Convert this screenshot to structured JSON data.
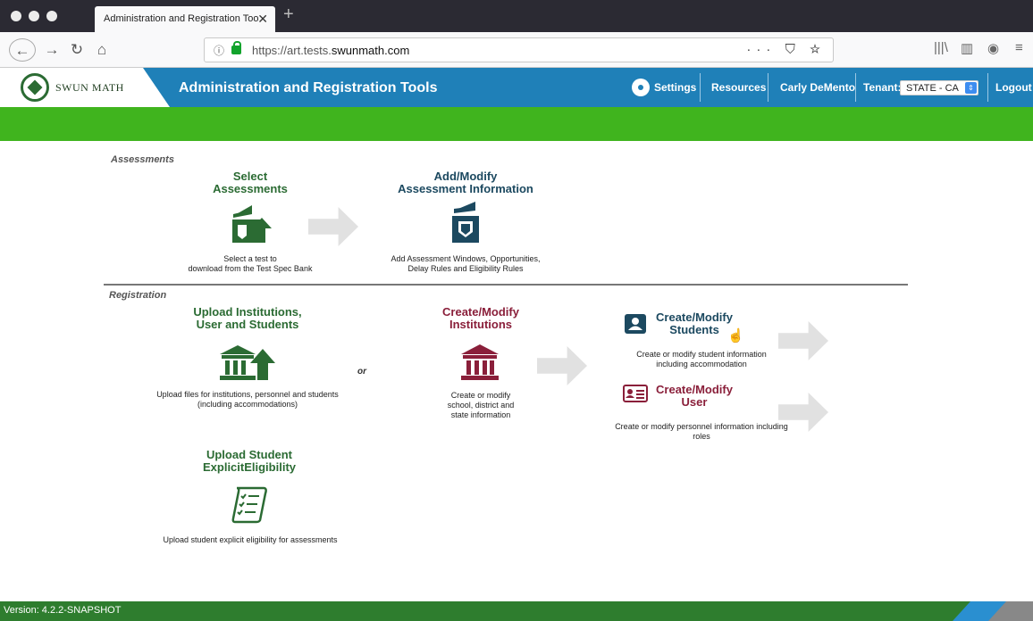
{
  "browser": {
    "tab_title": "Administration and Registration Too",
    "tab_close": "✕",
    "new_tab": "+",
    "url_prefix": "https://art.tests.",
    "url_domain": "swunmath.com",
    "url_actions": "··· ⛉ ☆",
    "back": "←",
    "forward": "→",
    "reload": "↻",
    "home": "⌂",
    "library": "|||\\",
    "sidebar": "▥",
    "extension": "◉",
    "menu": "≡"
  },
  "header": {
    "logo_text": "SWUN MATH",
    "app_title": "Administration and Registration Tools",
    "settings": "Settings",
    "resources": "Resources",
    "user": "Carly DeMento",
    "tenant_label": "Tenant:",
    "tenant_value": "STATE - CA",
    "logout": "Logout"
  },
  "assessments": {
    "section_label": "Assessments",
    "select": {
      "title_line1": "Select",
      "title_line2": "Assessments",
      "desc_line1": "Select a test to",
      "desc_line2": "download from the Test Spec Bank"
    },
    "modify": {
      "title_line1": "Add/Modify",
      "title_line2": "Assessment Information",
      "desc_line1": "Add Assessment Windows, Opportunities,",
      "desc_line2": "Delay Rules and Eligibility Rules"
    }
  },
  "registration": {
    "section_label": "Registration",
    "upload": {
      "title_line1": "Upload Institutions,",
      "title_line2": "User and Students",
      "desc_line1": "Upload files for institutions, personnel and students",
      "desc_line2": "(including accommodations)"
    },
    "or": "or",
    "institutions": {
      "title_line1": "Create/Modify",
      "title_line2": "Institutions",
      "desc_line1": "Create or modify",
      "desc_line2": "school, district and",
      "desc_line3": "state information"
    },
    "students": {
      "title_line1": "Create/Modify",
      "title_line2": "Students",
      "desc_line1": "Create or modify student information",
      "desc_line2": "including accommodation"
    },
    "user": {
      "title_line1": "Create/Modify",
      "title_line2": "User",
      "desc_line1": "Create or modify personnel information including",
      "desc_line2": "roles"
    },
    "eligibility": {
      "title_line1": "Upload Student",
      "title_line2": "ExplicitEligibility",
      "desc_line1": "Upload student explicit eligibility for assessments"
    }
  },
  "footer": {
    "version": "Version: 4.2.2-SNAPSHOT"
  }
}
